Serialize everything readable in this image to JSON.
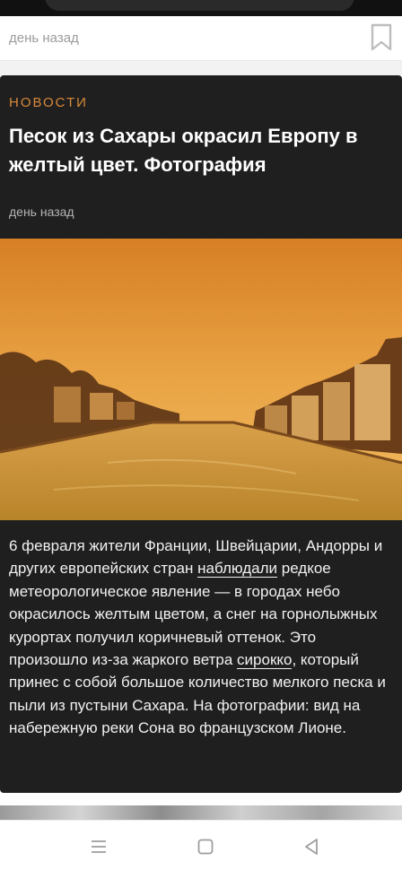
{
  "previous_card": {
    "time": "день назад"
  },
  "article": {
    "category": "НОВОСТИ",
    "title": "Песок из Сахары окрасил Европу в желтый цвет. Фотография",
    "time": "день назад",
    "body": {
      "part1": "6 февраля жители Франции, Швейцарии, Андорры и других европейских стран ",
      "link1": "наблюдали",
      "part2": " редкое метеорологическое явление — в городах небо окрасилось желтым цветом, а снег на горнолыжных курортах получил коричневый оттенок. Это произошло из-за жаркого ветра ",
      "link2": "сирокко",
      "part3": ", который принес с собой большое количество мелкого песка и пыли из пустыни Сахара. На фотографии: вид на набережную реки Сона во французском Лионе."
    }
  },
  "colors": {
    "card_background": "#1f1f1f",
    "category": "#d9893b",
    "sky": "#e0a040"
  },
  "icons": {
    "bookmark": "bookmark-icon",
    "nav_menu": "menu-icon",
    "nav_home": "home-icon",
    "nav_back": "back-icon"
  }
}
